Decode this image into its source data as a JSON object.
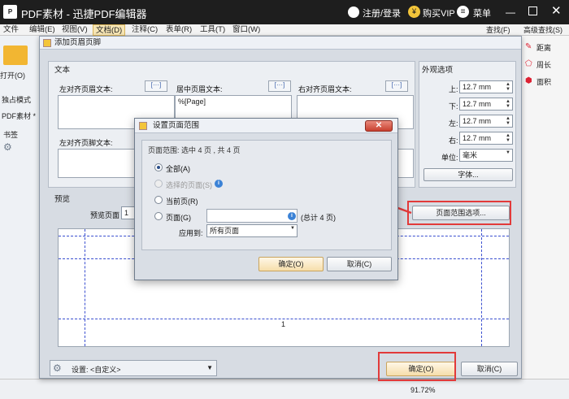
{
  "app": {
    "title": "PDF素材 - 迅捷PDF编辑器",
    "login": "注册/登录",
    "vip": "购买VIP",
    "menu": "菜单"
  },
  "menubar": [
    "文件",
    "编辑(E)",
    "视图(V)",
    "文档(D)",
    "注释(C)",
    "表单(R)",
    "工具(T)",
    "窗口(W)"
  ],
  "right_panel": {
    "find": "查找(F)",
    "adv_find": "高级查找(S)",
    "distance": "距离",
    "perimeter": "周长",
    "area": "面积"
  },
  "left_panel": {
    "open": "打开(O)",
    "exclusive": "独占模式",
    "doc_tab": "PDF素材 *",
    "bookmarks": "书签"
  },
  "dialog": {
    "title": "添加页眉页脚",
    "text_group": "文本",
    "left_header": "左对齐页眉文本:",
    "center_header": "居中页眉文本:",
    "right_header": "右对齐页眉文本:",
    "center_header_value": "%[Page]",
    "left_footer": "左对齐页脚文本:",
    "insert_btn": "[···]",
    "appearance": "外观选项",
    "margins": [
      {
        "label": "上:",
        "value": "12.7 mm"
      },
      {
        "label": "下:",
        "value": "12.7 mm"
      },
      {
        "label": "左:",
        "value": "12.7 mm"
      },
      {
        "label": "右:",
        "value": "12.7 mm"
      }
    ],
    "unit_label": "单位:",
    "unit_value": "毫米",
    "font_btn": "字体...",
    "preview": "预览",
    "preview_page_label": "预览页面",
    "preview_page_value": "1",
    "page_range_btn": "页面范围选项...",
    "preview_footer_number": "1",
    "settings_label": "设置: <自定义>",
    "ok": "确定(O)",
    "cancel": "取消(C)"
  },
  "modal": {
    "title": "设置页面范围",
    "range_info": "页面范围: 选中 4 页 , 共 4 页",
    "all": "全部(A)",
    "selected": "选择的页面(S)",
    "current": "当前页(R)",
    "pages": "页面(G)",
    "total": "(总计 4 页)",
    "apply_label": "应用到:",
    "apply_value": "所有页面",
    "ok": "确定(O)",
    "cancel": "取消(C)"
  },
  "statusbar": {
    "zoom": "91.72%"
  },
  "colors": {
    "titlebar": "#1e1e1e",
    "highlight": "#e23a3a",
    "dialog_bg": "#d7dce3"
  }
}
